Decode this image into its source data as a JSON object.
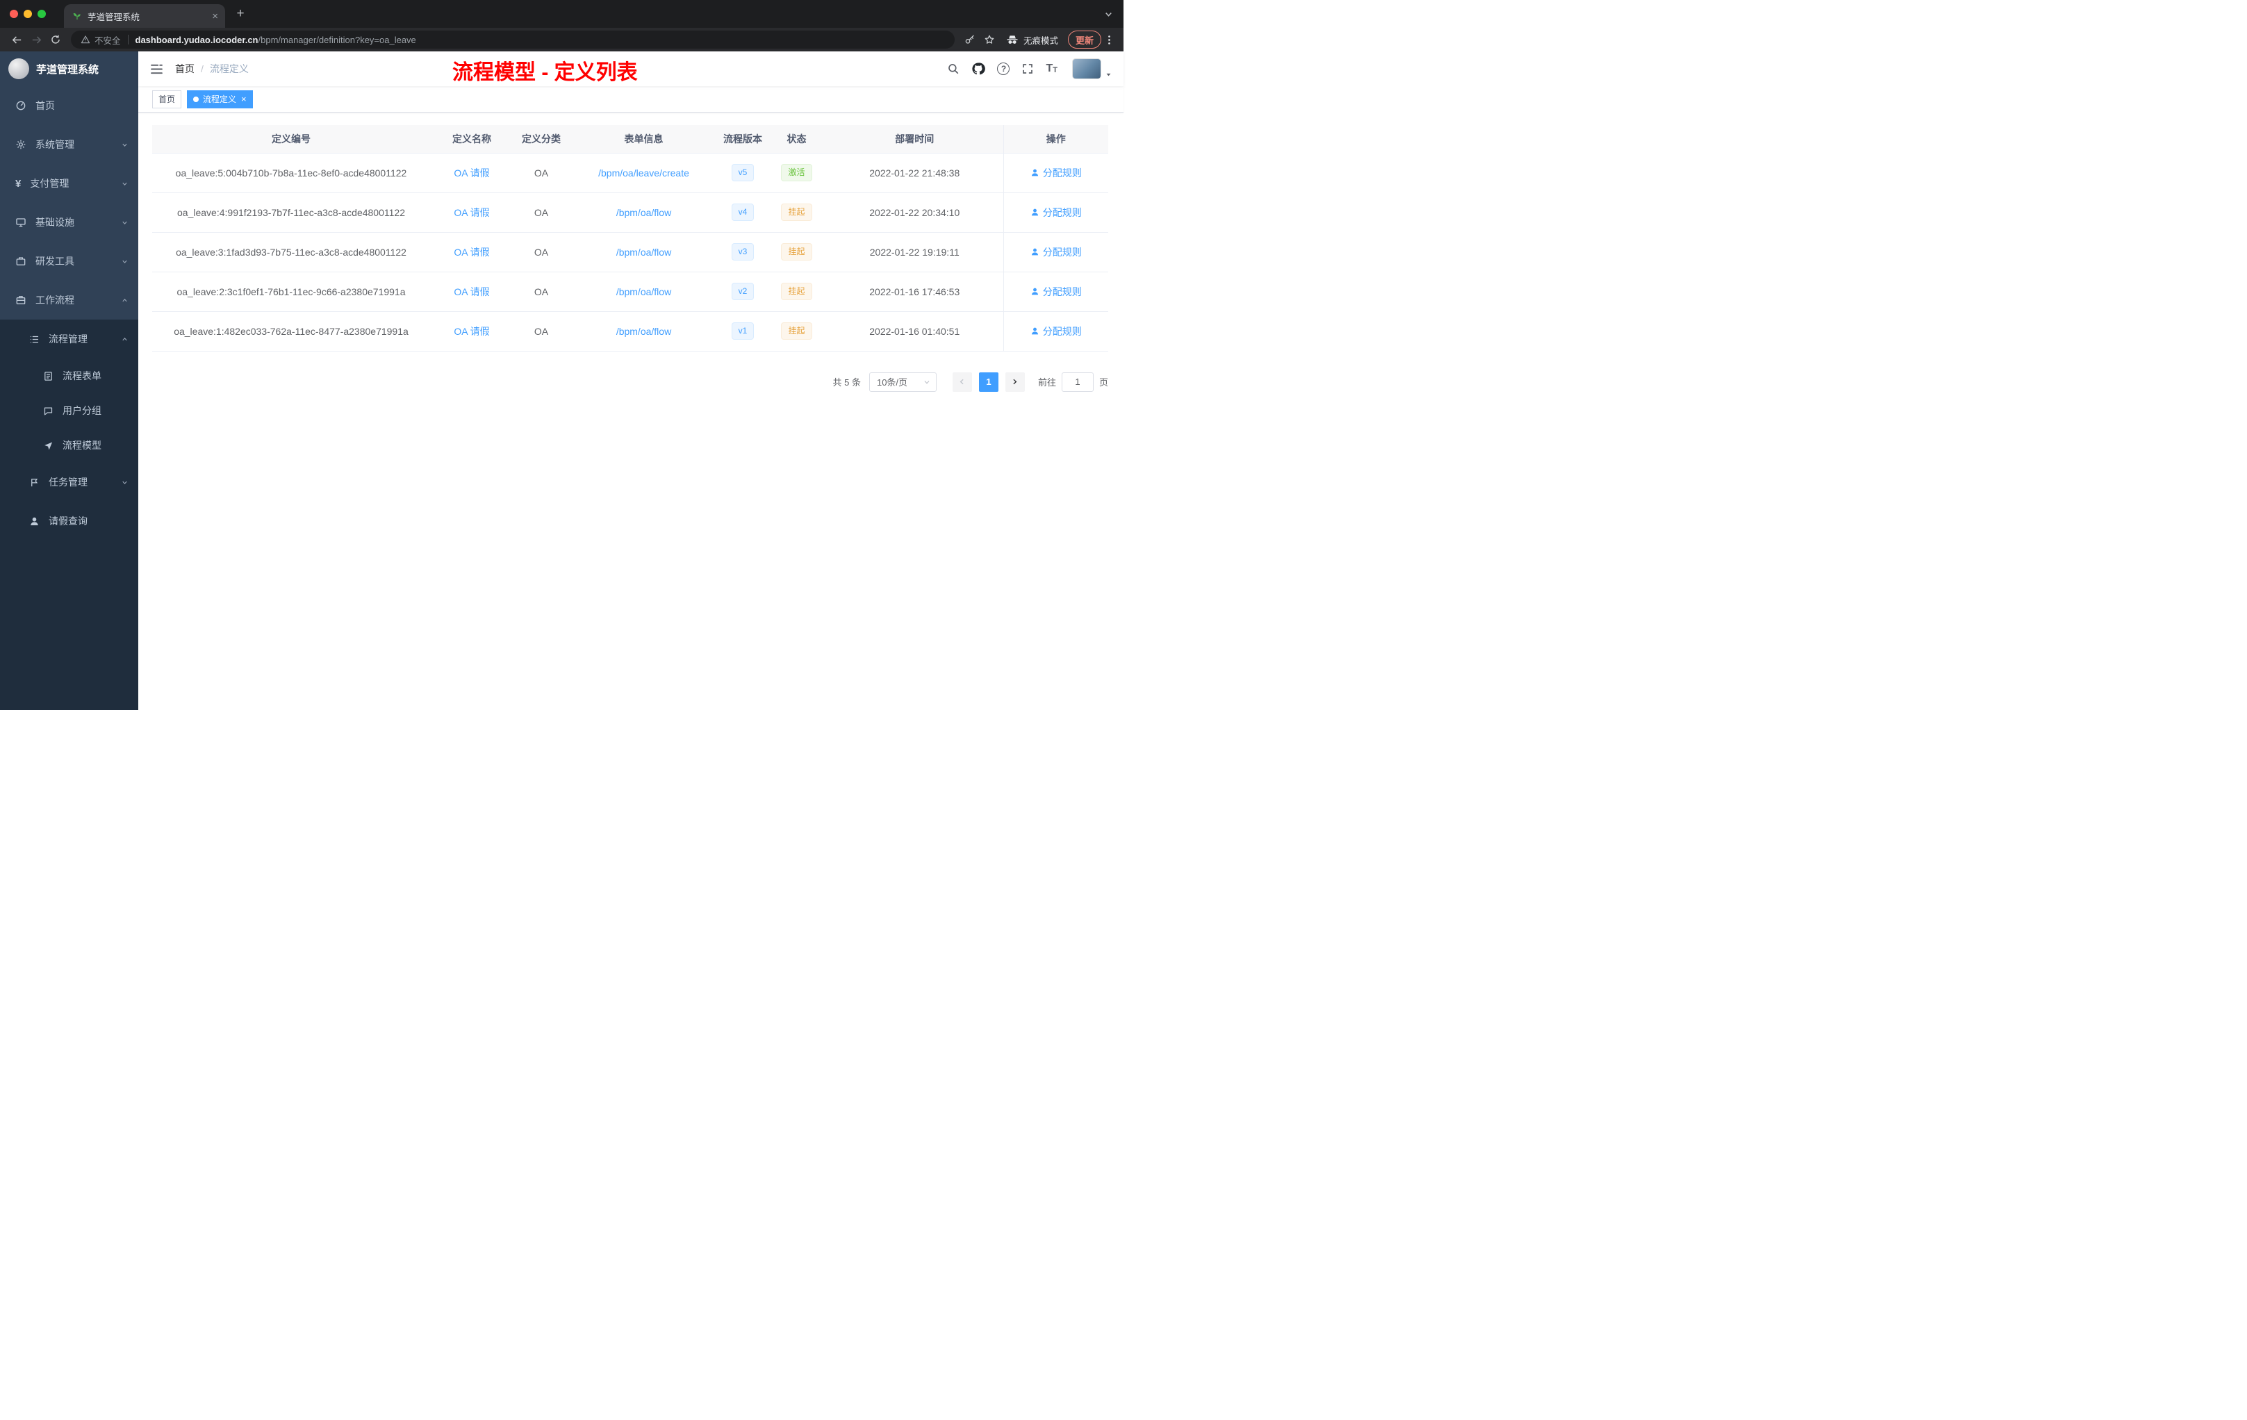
{
  "browser": {
    "tab_title": "芋道管理系统",
    "security_label": "不安全",
    "url_host": "dashboard.yudao.iocoder.cn",
    "url_path": "/bpm/manager/definition?key=oa_leave",
    "incognito_label": "无痕模式",
    "update_label": "更新"
  },
  "sidebar": {
    "logo_title": "芋道管理系统",
    "items": [
      {
        "label": "首页",
        "icon": "gauge-icon"
      },
      {
        "label": "系统管理",
        "icon": "gear-icon"
      },
      {
        "label": "支付管理",
        "icon": "yen-icon"
      },
      {
        "label": "基础设施",
        "icon": "monitor-icon"
      },
      {
        "label": "研发工具",
        "icon": "toolbox-icon"
      },
      {
        "label": "工作流程",
        "icon": "briefcase-icon"
      }
    ],
    "process_mgmt": "流程管理",
    "process_form": "流程表单",
    "user_group": "用户分组",
    "process_model": "流程模型",
    "task_mgmt": "任务管理",
    "leave_query": "请假查询"
  },
  "header": {
    "breadcrumb_home": "首页",
    "breadcrumb_current": "流程定义",
    "annotation": "流程模型 - 定义列表"
  },
  "tags": {
    "home": "首页",
    "current": "流程定义"
  },
  "table": {
    "columns": [
      "定义编号",
      "定义名称",
      "定义分类",
      "表单信息",
      "流程版本",
      "状态",
      "部署时间",
      "操作"
    ],
    "action_label": "分配规则",
    "rows": [
      {
        "id": "oa_leave:5:004b710b-7b8a-11ec-8ef0-acde48001122",
        "name": "OA 请假",
        "category": "OA",
        "form": "/bpm/oa/leave/create",
        "version": "v5",
        "status": "激活",
        "status_type": "success",
        "time": "2022-01-22 21:48:38"
      },
      {
        "id": "oa_leave:4:991f2193-7b7f-11ec-a3c8-acde48001122",
        "name": "OA 请假",
        "category": "OA",
        "form": "/bpm/oa/flow",
        "version": "v4",
        "status": "挂起",
        "status_type": "warning",
        "time": "2022-01-22 20:34:10"
      },
      {
        "id": "oa_leave:3:1fad3d93-7b75-11ec-a3c8-acde48001122",
        "name": "OA 请假",
        "category": "OA",
        "form": "/bpm/oa/flow",
        "version": "v3",
        "status": "挂起",
        "status_type": "warning",
        "time": "2022-01-22 19:19:11"
      },
      {
        "id": "oa_leave:2:3c1f0ef1-76b1-11ec-9c66-a2380e71991a",
        "name": "OA 请假",
        "category": "OA",
        "form": "/bpm/oa/flow",
        "version": "v2",
        "status": "挂起",
        "status_type": "warning",
        "time": "2022-01-16 17:46:53"
      },
      {
        "id": "oa_leave:1:482ec033-762a-11ec-8477-a2380e71991a",
        "name": "OA 请假",
        "category": "OA",
        "form": "/bpm/oa/flow",
        "version": "v1",
        "status": "挂起",
        "status_type": "warning",
        "time": "2022-01-16 01:40:51"
      }
    ]
  },
  "pagination": {
    "total": "共 5 条",
    "page_size": "10条/页",
    "current_page": "1",
    "goto_label": "前往",
    "goto_value": "1",
    "page_unit": "页"
  },
  "glyphs": {
    "close": "×",
    "plus": "+",
    "question": "?",
    "yen": "¥",
    "font_large": "T",
    "font_small": "T"
  },
  "colors": {
    "accent": "#409eff",
    "success": "#67c23a",
    "warning": "#e6a23c",
    "annotation": "#ff0000",
    "sidebar_bg": "#304156",
    "submenu_bg": "#1f2d3d"
  }
}
